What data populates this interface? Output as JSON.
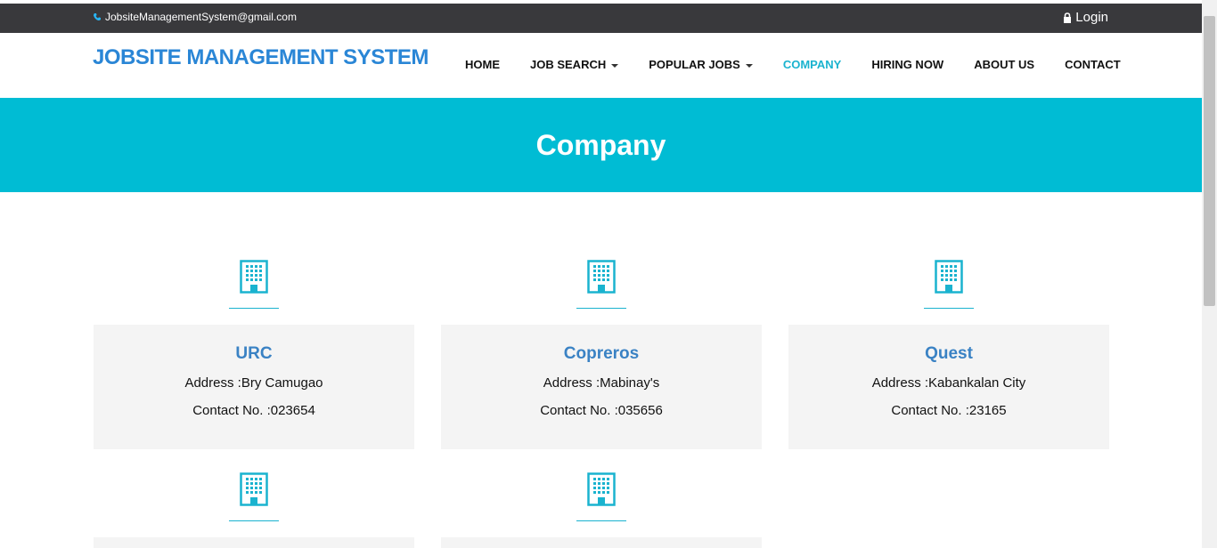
{
  "topbar": {
    "email": "JobsiteManagementSystem@gmail.com",
    "login": "Login"
  },
  "navbar": {
    "brand": "JOBSITE MANAGEMENT SYSTEM",
    "items": [
      {
        "label": "HOME",
        "dropdown": false,
        "active": false
      },
      {
        "label": "JOB SEARCH",
        "dropdown": true,
        "active": false
      },
      {
        "label": "POPULAR JOBS",
        "dropdown": true,
        "active": false
      },
      {
        "label": "COMPANY",
        "dropdown": false,
        "active": true
      },
      {
        "label": "HIRING NOW",
        "dropdown": false,
        "active": false
      },
      {
        "label": "ABOUT US",
        "dropdown": false,
        "active": false
      },
      {
        "label": "CONTACT",
        "dropdown": false,
        "active": false
      }
    ]
  },
  "banner": {
    "title": "Company"
  },
  "companies": [
    {
      "name": "URC",
      "address": "Address :Bry Camugao",
      "contact": "Contact No. :023654"
    },
    {
      "name": "Copreros",
      "address": "Address :Mabinay's",
      "contact": "Contact No. :035656"
    },
    {
      "name": "Quest",
      "address": "Address :Kabankalan City",
      "contact": "Contact No. :23165"
    }
  ],
  "colors": {
    "accent": "#00bcd4",
    "brand": "#2a86d6",
    "company_name": "#3a82c4",
    "topbar": "#39393c"
  },
  "icons": {
    "phone": "phone-icon",
    "lock": "lock-icon",
    "company": "building-icon"
  }
}
